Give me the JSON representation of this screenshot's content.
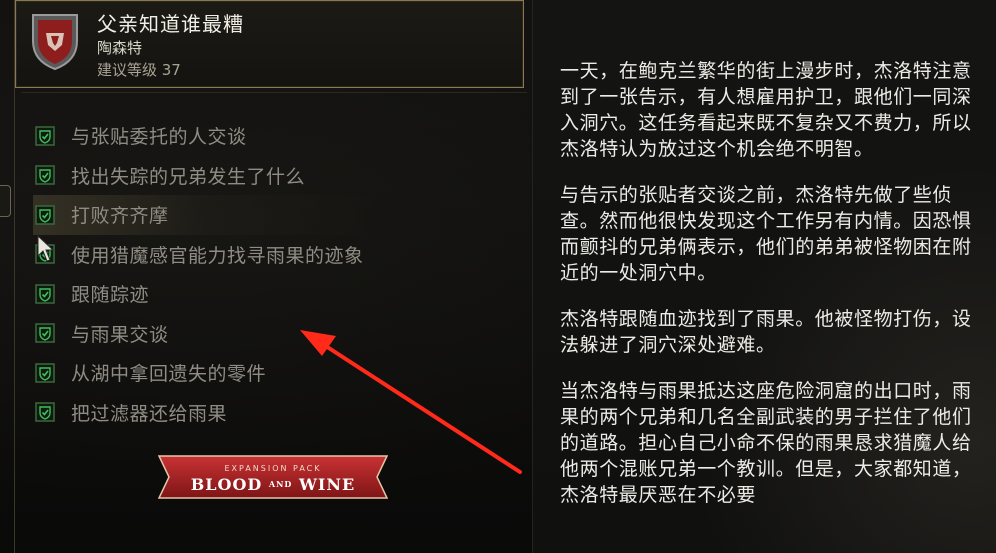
{
  "quest": {
    "title": "父亲知道谁最糟",
    "giver": "陶森特",
    "level": "建议等级 37",
    "crest_icon": "red-shield-heraldry-icon"
  },
  "objectives": [
    {
      "label": "与张贴委托的人交谈",
      "completed": true
    },
    {
      "label": "找出失踪的兄弟发生了什么",
      "completed": true
    },
    {
      "label": "打败齐齐摩",
      "completed": true
    },
    {
      "label": "使用猎魔感官能力找寻雨果的迹象",
      "completed": true
    },
    {
      "label": "跟随踪迹",
      "completed": true
    },
    {
      "label": "与雨果交谈",
      "completed": true
    },
    {
      "label": "从湖中拿回遗失的零件",
      "completed": true
    },
    {
      "label": "把过滤器还给雨果",
      "completed": true
    }
  ],
  "expansion_badge": {
    "top": "EXPANSION PACK",
    "main_left": "BLOOD",
    "main_mid": "AND",
    "main_right": "WINE"
  },
  "description": [
    "一天，在鲍克兰繁华的街上漫步时，杰洛特注意到了一张告示，有人想雇用护卫，跟他们一同深入洞穴。这任务看起来既不复杂又不费力，所以杰洛特认为放过这个机会绝不明智。",
    "与告示的张贴者交谈之前，杰洛特先做了些侦查。然而他很快发现这个工作另有内情。因恐惧而颤抖的兄弟俩表示，他们的弟弟被怪物困在附近的一处洞穴中。",
    "杰洛特跟随血迹找到了雨果。他被怪物打伤，设法躲进了洞穴深处避难。",
    "当杰洛特与雨果抵达这座危险洞窟的出口时，雨果的两个兄弟和几名全副武装的男子拦住了他们的道路。担心自己小命不保的雨果恳求猎魔人给他两个混账兄弟一个教训。但是，大家都知道，杰洛特最厌恶在不必要"
  ],
  "colors": {
    "frame_gold": "#8a7a4e",
    "check_green": "#3fbf5a",
    "annotation_red": "#ff2a1a",
    "badge_red": "#b8282a"
  }
}
